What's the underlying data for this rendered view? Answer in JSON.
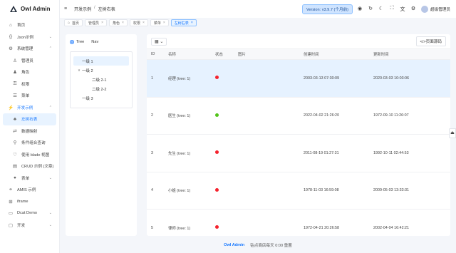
{
  "app": {
    "title": "Owl Admin"
  },
  "sidebar": {
    "items": [
      {
        "label": "首页",
        "icon": "home-icon",
        "glyph": "⌂",
        "level": 0
      },
      {
        "label": "Json示例",
        "icon": "json-icon",
        "glyph": "{}",
        "level": 0,
        "chevron": "⌄"
      },
      {
        "label": "系统管理",
        "icon": "settings-icon",
        "glyph": "⚙",
        "level": 0,
        "chevron": "⌃"
      },
      {
        "label": "管理员",
        "icon": "user-icon",
        "glyph": "♙",
        "level": 1
      },
      {
        "label": "角色",
        "icon": "users-icon",
        "glyph": "♟",
        "level": 1
      },
      {
        "label": "权限",
        "icon": "lock-icon",
        "glyph": "⚿",
        "level": 1
      },
      {
        "label": "菜单",
        "icon": "menu-icon",
        "glyph": "☰",
        "level": 1
      },
      {
        "label": "开发示例",
        "icon": "lightning-icon",
        "glyph": "⚡",
        "level": 0,
        "chevron": "⌃",
        "open": true
      },
      {
        "label": "左树右表",
        "icon": "tree-icon",
        "glyph": "♣",
        "level": 1,
        "active": true
      },
      {
        "label": "数据映射",
        "icon": "mapping-icon",
        "glyph": "⇄",
        "level": 1
      },
      {
        "label": "条件组合查询",
        "icon": "filter-icon",
        "glyph": "⚲",
        "level": 1
      },
      {
        "label": "使用 blade 视图",
        "icon": "blade-icon",
        "glyph": "♡",
        "level": 1
      },
      {
        "label": "CRUD 示例 (文章)",
        "icon": "crud-icon",
        "glyph": "▤",
        "level": 1
      },
      {
        "label": "表单",
        "icon": "form-icon",
        "glyph": "●",
        "level": 1,
        "chevron": "⌄"
      },
      {
        "label": "AMIS 示例",
        "icon": "link-icon",
        "glyph": "⚭",
        "level": 0
      },
      {
        "label": "iframe",
        "icon": "iframe-icon",
        "glyph": "⊞",
        "level": 0
      },
      {
        "label": "Dcat Demo",
        "icon": "folder-icon",
        "glyph": "▭",
        "level": 0,
        "chevron": "⌄"
      },
      {
        "label": "开发",
        "icon": "code-icon",
        "glyph": "▢",
        "level": 0,
        "chevron": "⌄"
      }
    ]
  },
  "header": {
    "toggle_icon": "≡",
    "breadcrumb": [
      "开发示例",
      "左树右表"
    ],
    "breadcrumb_sep": "/",
    "version": "Version: v3.9.7 (个月前)",
    "icons": [
      {
        "name": "github-icon",
        "glyph": "◉"
      },
      {
        "name": "refresh-icon",
        "glyph": "↻"
      },
      {
        "name": "dark-mode-icon",
        "glyph": "☾"
      },
      {
        "name": "fullscreen-icon",
        "glyph": "⛶"
      },
      {
        "name": "translate-icon",
        "glyph": "文"
      },
      {
        "name": "settings-icon",
        "glyph": "⚙"
      }
    ],
    "user": "超级管理员"
  },
  "tabs": [
    {
      "label": "首页",
      "icon": "⌂"
    },
    {
      "label": "管理员",
      "close": "×"
    },
    {
      "label": "角色",
      "close": "×"
    },
    {
      "label": "权限",
      "close": "×"
    },
    {
      "label": "菜单",
      "close": "×"
    },
    {
      "label": "左树右表",
      "close": "×",
      "active": true
    }
  ],
  "tree": {
    "tab_tree": "Tree",
    "tab_nav": "Nav",
    "nodes": [
      {
        "label": "一级 1",
        "depth": 0,
        "selected": true
      },
      {
        "label": "一级 2",
        "depth": 0,
        "caret": "∨"
      },
      {
        "label": "二级 2-1",
        "depth": 1
      },
      {
        "label": "二级 2-2",
        "depth": 1
      },
      {
        "label": "一级 3",
        "depth": 0
      }
    ]
  },
  "table": {
    "toolbar_icon": "▦ ⌄",
    "source_button": "</>页面源码",
    "columns": [
      "ID",
      "名称",
      "状态",
      "图片",
      "创建时间",
      "更新时间"
    ],
    "colors": {
      "red": "#f5222d",
      "green": "#52c41a"
    },
    "rows": [
      {
        "id": "1",
        "name": "经理 (tree: 1)",
        "status": "red",
        "image": "",
        "created": "2003-03-13 07:30:09",
        "updated": "2020-03-03 10:03:06",
        "selected": true
      },
      {
        "id": "2",
        "name": "医生 (tree: 1)",
        "status": "green",
        "image": "",
        "created": "2022-04-02 21:26:20",
        "updated": "1972-09-10 11:26:07"
      },
      {
        "id": "3",
        "name": "先生 (tree: 1)",
        "status": "red",
        "image": "",
        "created": "2011-08-19 01:27:31",
        "updated": "1992-10-11 02:44:53"
      },
      {
        "id": "4",
        "name": "小姐 (tree: 1)",
        "status": "red",
        "image": "",
        "created": "1978-11-03 16:59:08",
        "updated": "2009-05-03 13:33:31"
      },
      {
        "id": "5",
        "name": "律师 (tree: 1)",
        "status": "red",
        "image": "",
        "created": "1972-04-21 20:26:58",
        "updated": "2002-04-04 16:42:21"
      }
    ]
  },
  "footer": {
    "brand": "Owl Admin",
    "text": "钻点商店每天 0:00 重置"
  },
  "float_tab": {
    "icon": "⏏"
  }
}
